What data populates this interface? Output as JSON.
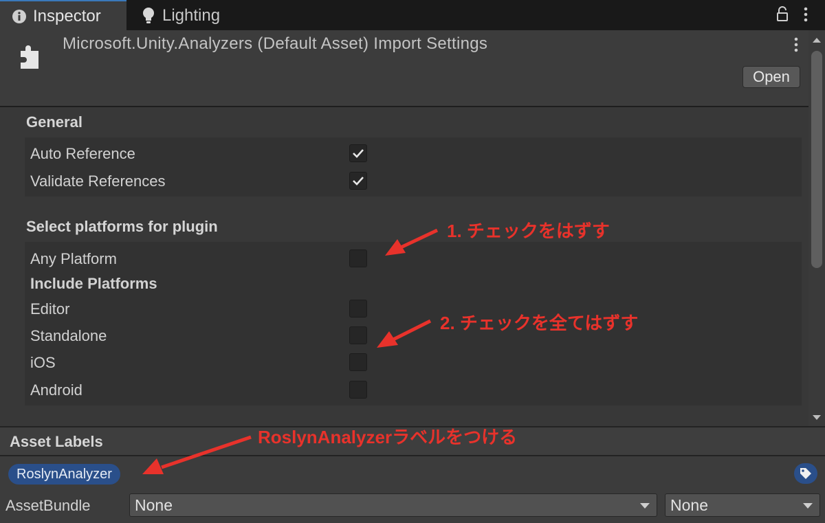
{
  "tabs": [
    {
      "label": "Inspector",
      "icon": "info-icon",
      "active": true
    },
    {
      "label": "Lighting",
      "icon": "lightbulb-icon",
      "active": false
    }
  ],
  "header": {
    "title": "Microsoft.Unity.Analyzers (Default Asset) Import Settings",
    "open_label": "Open"
  },
  "general": {
    "title": "General",
    "rows": [
      {
        "label": "Auto Reference",
        "checked": true
      },
      {
        "label": "Validate References",
        "checked": true
      }
    ]
  },
  "platforms": {
    "title": "Select platforms for plugin",
    "any_platform": {
      "label": "Any Platform",
      "checked": false
    },
    "include_title": "Include Platforms",
    "rows": [
      {
        "label": "Editor",
        "checked": false
      },
      {
        "label": "Standalone",
        "checked": false
      },
      {
        "label": "iOS",
        "checked": false
      },
      {
        "label": "Android",
        "checked": false
      }
    ]
  },
  "asset_labels": {
    "title": "Asset Labels",
    "chip": "RoslynAnalyzer"
  },
  "asset_bundle": {
    "label": "AssetBundle",
    "name_value": "None",
    "variant_value": "None"
  },
  "annotations": {
    "a1": "1. チェックをはずす",
    "a2": "2. チェックを全てはずす",
    "a3": "RoslynAnalyzerラベルをつける"
  },
  "colors": {
    "accent": "#3a79bb",
    "annotation": "#e8322b",
    "chip": "#2a4f8a"
  }
}
